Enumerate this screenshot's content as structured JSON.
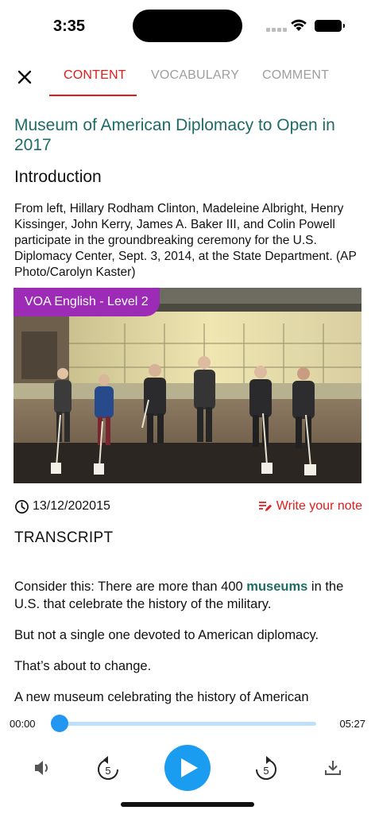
{
  "status_bar": {
    "time": "3:35"
  },
  "tabs": [
    {
      "label": "CONTENT",
      "active": true
    },
    {
      "label": "VOCABULARY",
      "active": false
    },
    {
      "label": "COMMENT",
      "active": false
    }
  ],
  "article": {
    "title": "Museum of American Diplomacy to Open in 2017",
    "section": "Introduction",
    "caption": " From left, Hillary Rodham Clinton, Madeleine Albright, Henry Kissinger, John Kerry, James A. Baker III, and Colin Powell participate in the groundbreaking ceremony for the U.S. Diplomacy Center, Sept. 3, 2014, at the State Department. (AP Photo/Carolyn Kaster)",
    "level_badge": "VOA English - Level 2",
    "date": "13/12/202015",
    "write_note": "Write your note",
    "transcript_heading": "TRANSCRIPT",
    "transcript": {
      "p1_before": "Consider this: There are more than 400 ",
      "p1_vocab": "museums",
      "p1_after": " in the U.S. that celebrate the history of the military.",
      "p2": "But not a single one devoted to American diplomacy.",
      "p3": "That’s about to change.",
      "p4": "A new museum celebrating the history of American"
    }
  },
  "player": {
    "time_current": "00:00",
    "time_total": "05:27",
    "progress": 0,
    "icons": {
      "volume": "volume-icon",
      "rewind": "rewind-5-icon",
      "play": "play-icon",
      "forward": "forward-5-icon",
      "download": "download-icon"
    }
  },
  "colors": {
    "accent_red": "#e21b1b",
    "title_teal": "#1f6b67",
    "badge_purple": "#9c2bb5",
    "player_blue": "#1a9cf0"
  }
}
